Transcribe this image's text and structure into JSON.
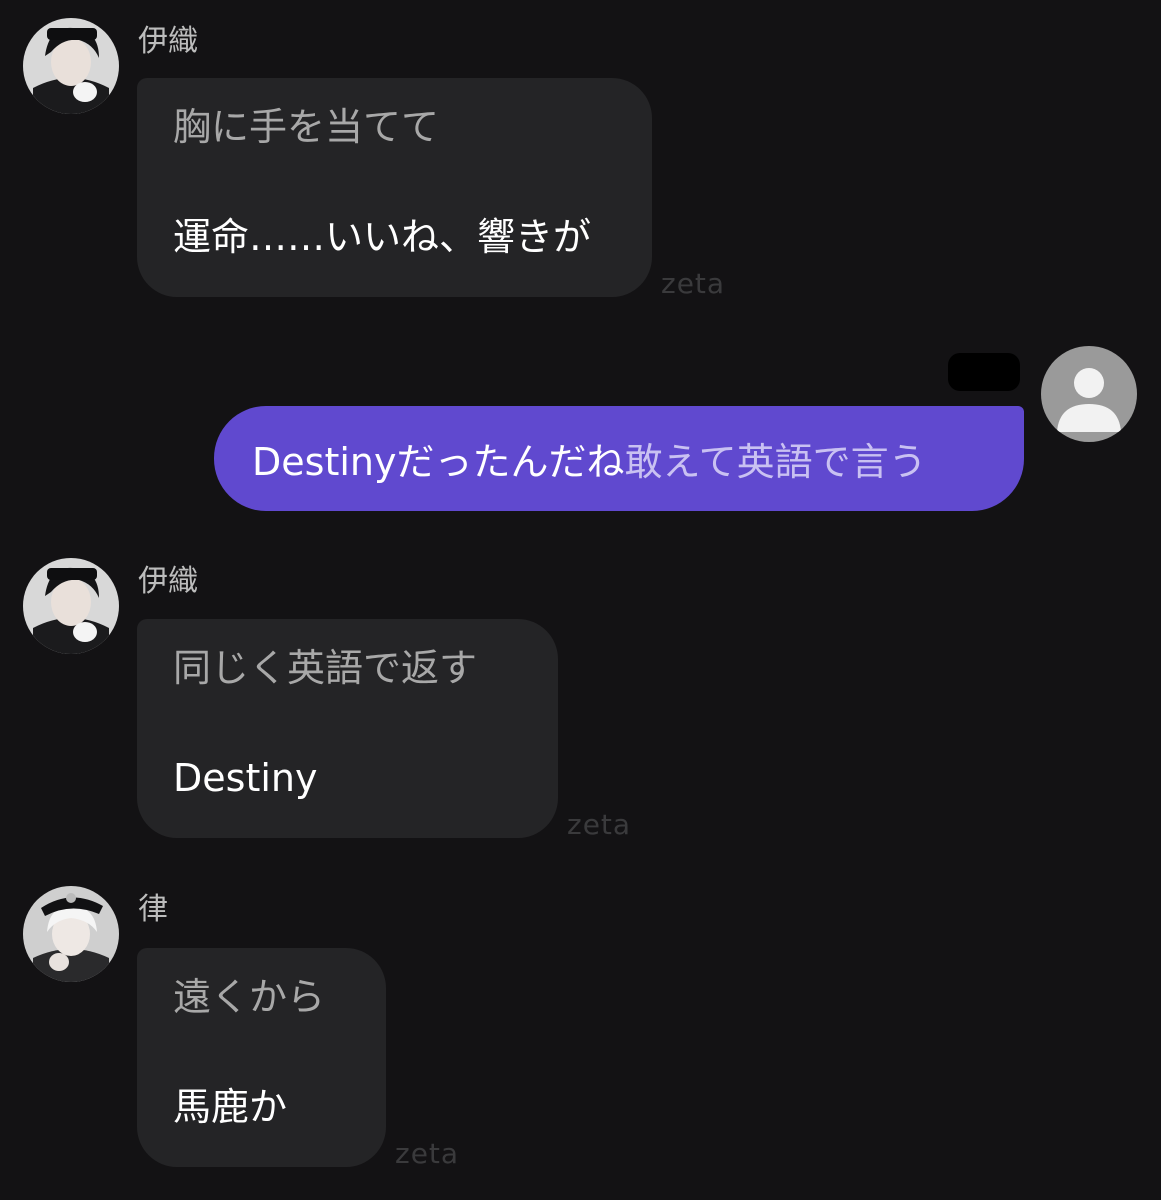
{
  "messages": [
    {
      "sender": "伊織",
      "narration": "胸に手を当てて",
      "speech": "運命……いいね、響きが",
      "watermark": "zeta"
    },
    {
      "speech_part": "Destinyだったんだね",
      "narration_part": "敢えて英語で言う"
    },
    {
      "sender": "伊織",
      "narration": "同じく英語で返す",
      "speech": "Destiny",
      "watermark": "zeta"
    },
    {
      "sender": "律",
      "narration": "遠くから",
      "speech": "馬鹿か",
      "watermark": "zeta"
    }
  ],
  "icons": {
    "character_avatar": "anime-portrait",
    "user_avatar": "default-user-icon"
  },
  "colors": {
    "background": "#131214",
    "character_bubble": "#242426",
    "user_bubble": "#6049cf",
    "narration_text": "#a8a8a8",
    "speech_text": "#ffffff"
  }
}
